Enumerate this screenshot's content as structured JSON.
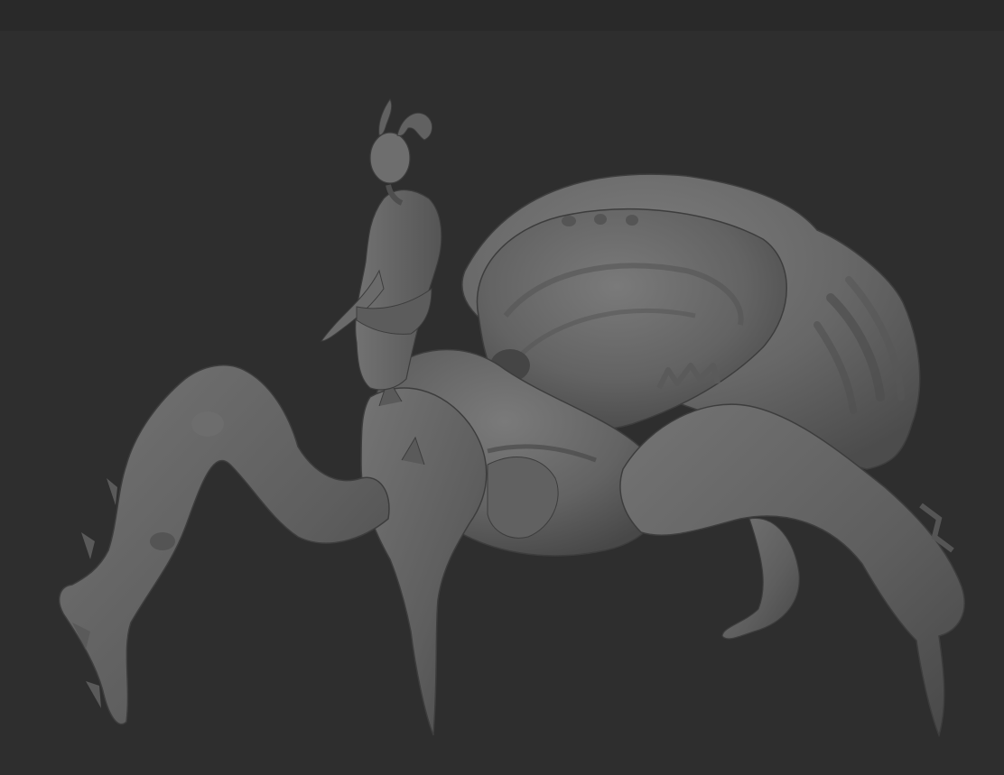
{
  "app": {
    "title": "",
    "background_color": "#2e2e2e",
    "topbar_color": "#292929"
  },
  "viewport": {
    "subject": "sculpted-creature-model",
    "material_color": "#6b6b6b",
    "shadow_color": "#4a4a4a",
    "highlight_color": "#8a8a8a"
  }
}
